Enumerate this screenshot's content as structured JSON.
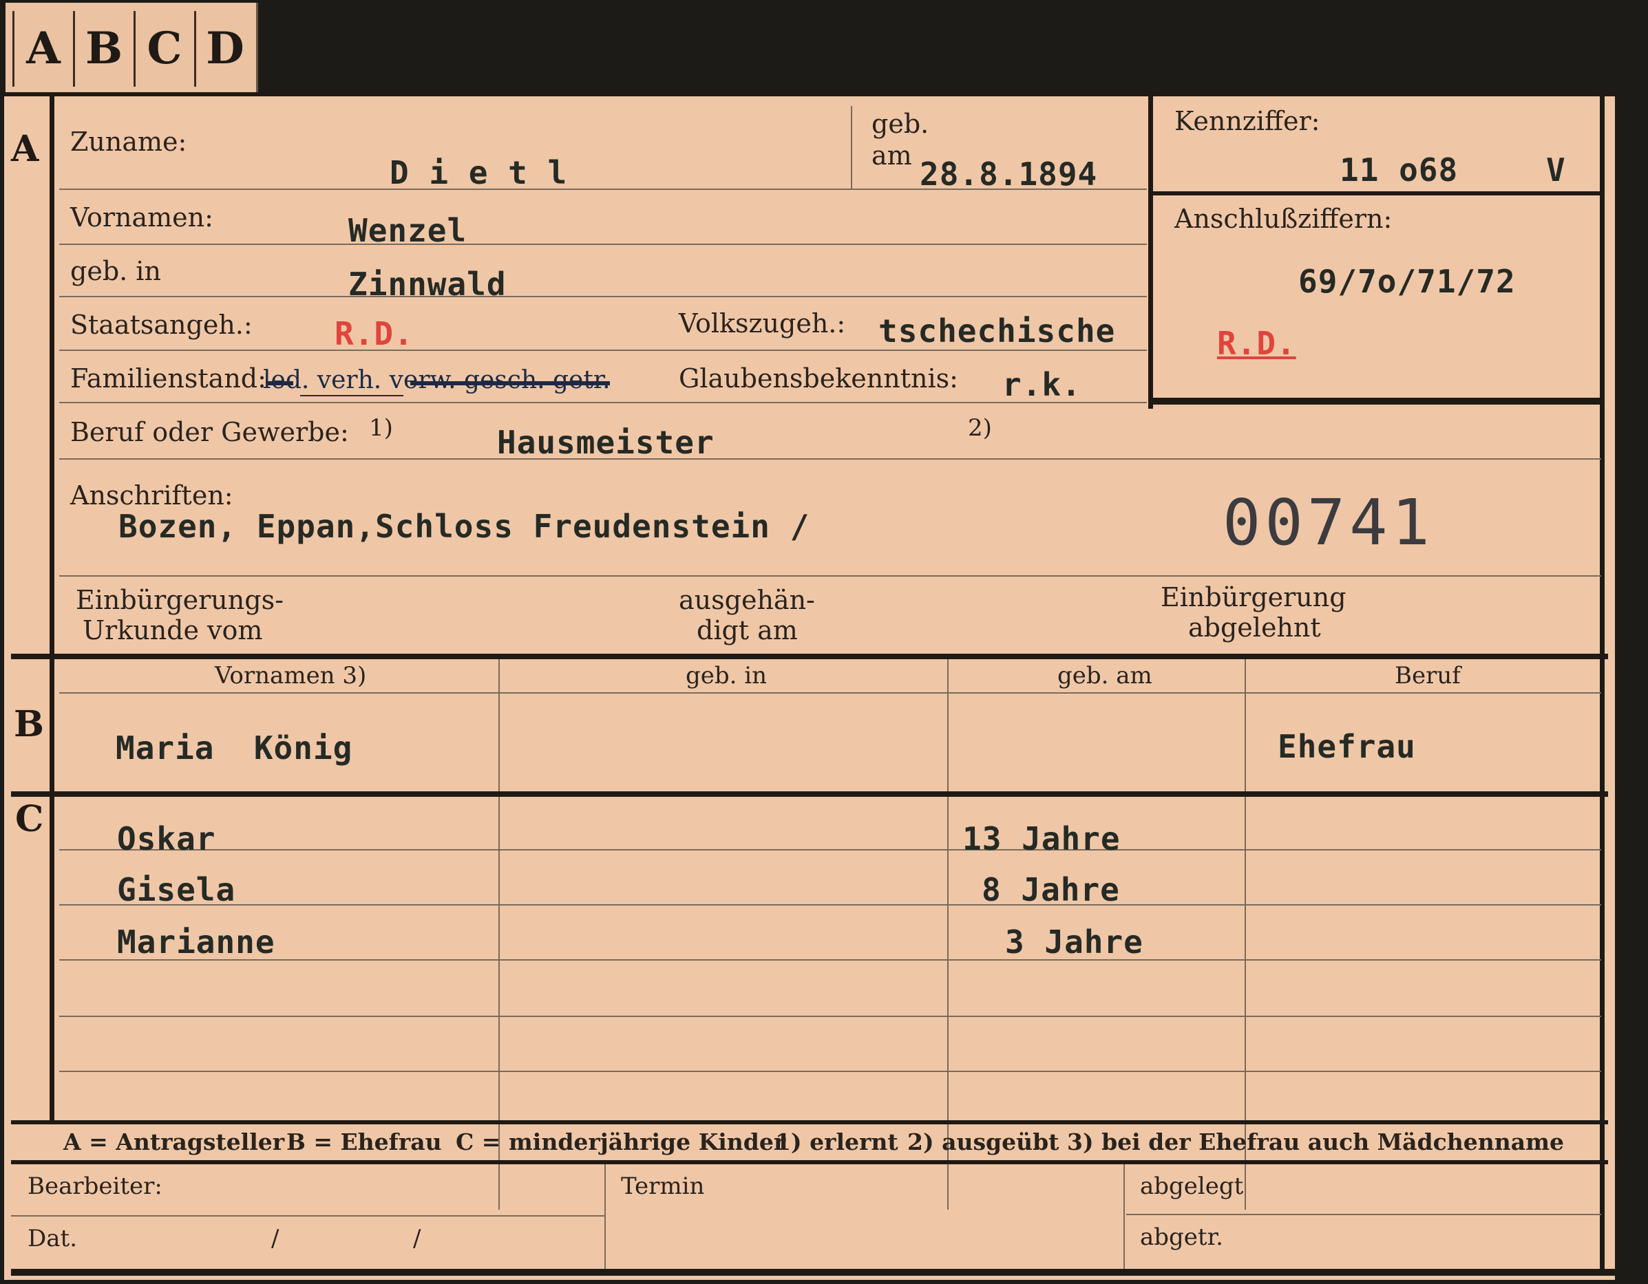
{
  "tabs": [
    "A",
    "B",
    "C",
    "D"
  ],
  "section_a": {
    "marker": "A",
    "zuname_label": "Zuname:",
    "zuname_value": "D i e t l",
    "geb_label": "geb.",
    "am_label": "am",
    "geb_am_value": "28.8.1894",
    "vornamen_label": "Vornamen:",
    "vornamen_value": "Wenzel",
    "geb_in_label": "geb. in",
    "geb_in_value": "Zinnwald",
    "staatsangeh_label": "Staatsangeh.:",
    "staatsangeh_value": "R.D.",
    "volkszugeh_label": "Volkszugeh.:",
    "volkszugeh_value": "tschechische",
    "familienstand_label": "Familienstand:",
    "familienstand_value": "led. verh. verw. gesch. getr.",
    "glauben_label": "Glaubensbekenntnis:",
    "glauben_value": "r.k.",
    "beruf_label": "Beruf oder Gewerbe:",
    "beruf_note1": "1)",
    "beruf_value": "Hausmeister",
    "beruf_note2": "2)",
    "anschriften_label": "Anschriften:",
    "anschriften_value": "Bozen, Eppan,Schloss Freudenstein /",
    "stamp_number": "00741",
    "einb_urkunde_label_1": "Einbürgerungs-",
    "einb_urkunde_label_2": "Urkunde vom",
    "ausgehaendigt_label_1": "ausgehän-",
    "ausgehaendigt_label_2": "digt am",
    "einb_abgelehnt_label_1": "Einbürgerung",
    "einb_abgelehnt_label_2": "abgelehnt"
  },
  "kennziffer": {
    "label": "Kennziffer:",
    "value": "11 o68",
    "suffix": "V",
    "anschluss_label": "Anschlußziffern:",
    "anschluss_value": "69/7o/71/72",
    "anschluss_mark": "R.D."
  },
  "section_b": {
    "marker": "B",
    "headers": [
      "Vornamen 3)",
      "geb. in",
      "geb. am",
      "Beruf"
    ],
    "row": [
      "Maria  König",
      "",
      "",
      "Ehefrau"
    ]
  },
  "section_c": {
    "marker": "C",
    "children": [
      {
        "name": "Oskar",
        "age": "13 Jahre"
      },
      {
        "name": "Gisela",
        "age": "8 Jahre"
      },
      {
        "name": "Marianne",
        "age": "3 Jahre"
      }
    ]
  },
  "legend": {
    "a": "A = Antragsteller",
    "b": "B = Ehefrau",
    "c": "C = minderjährige Kinder",
    "n1": "1) erlernt",
    "n2": "2) ausgeübt",
    "n3": "3) bei der Ehefrau auch Mädchenname"
  },
  "footer": {
    "bearbeiter_label": "Bearbeiter:",
    "dat_label": "Dat.",
    "dat_slash1": "/",
    "dat_slash2": "/",
    "termin_label": "Termin",
    "abgelegt_label": "abgelegt",
    "abgetr_label": "abgetr."
  }
}
